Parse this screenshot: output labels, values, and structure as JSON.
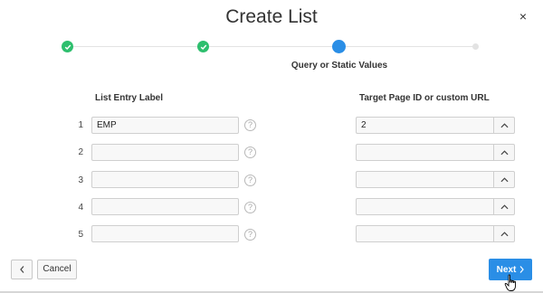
{
  "dialog": {
    "title": "Create List",
    "close_glyph": "×"
  },
  "wizard": {
    "steps": [
      {
        "state": "complete",
        "icon": "check-icon"
      },
      {
        "state": "complete",
        "icon": "check-icon"
      },
      {
        "state": "current",
        "label": "Query or Static Values"
      },
      {
        "state": "future"
      }
    ]
  },
  "table": {
    "header_label": "List Entry Label",
    "header_target": "Target Page ID or custom URL",
    "help_glyph": "?",
    "rows": [
      {
        "num": "1",
        "label": "EMP",
        "target": "2"
      },
      {
        "num": "2",
        "label": "",
        "target": ""
      },
      {
        "num": "3",
        "label": "",
        "target": ""
      },
      {
        "num": "4",
        "label": "",
        "target": ""
      },
      {
        "num": "5",
        "label": "",
        "target": ""
      }
    ]
  },
  "footer": {
    "cancel_label": "Cancel",
    "next_label": "Next"
  },
  "colors": {
    "complete": "#2ebf6e",
    "current": "#2a8ee6",
    "primary_button": "#2a8ee6"
  }
}
